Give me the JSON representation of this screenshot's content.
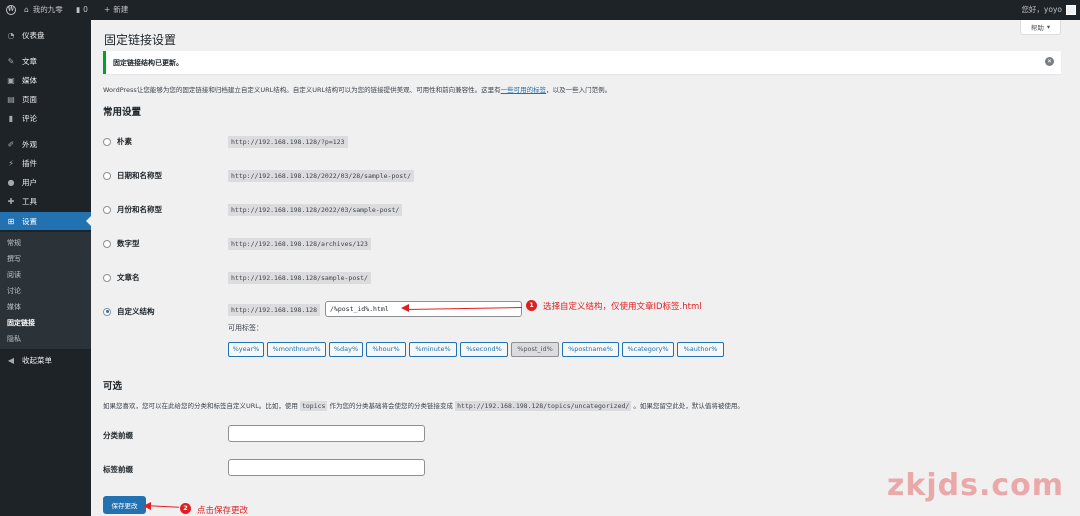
{
  "adminbar": {
    "site_name": "我的九零",
    "comments_count": "0",
    "new_label": "新建",
    "howdy": "您好，yoyo"
  },
  "sidebar": {
    "items": [
      {
        "label": "仪表盘",
        "icon": "dashboard-icon"
      },
      {
        "label": "文章",
        "icon": "pin-icon"
      },
      {
        "label": "媒体",
        "icon": "media-icon"
      },
      {
        "label": "页面",
        "icon": "page-icon"
      },
      {
        "label": "评论",
        "icon": "comment-icon"
      },
      {
        "label": "外观",
        "icon": "brush-icon"
      },
      {
        "label": "插件",
        "icon": "plugin-icon"
      },
      {
        "label": "用户",
        "icon": "user-icon"
      },
      {
        "label": "工具",
        "icon": "wrench-icon"
      },
      {
        "label": "设置",
        "icon": "settings-icon",
        "active": true
      }
    ],
    "submenu": [
      "常规",
      "撰写",
      "阅读",
      "讨论",
      "媒体",
      "固定链接",
      "隐私"
    ],
    "current_submenu": "固定链接",
    "collapse_label": "收起菜单"
  },
  "help_label": "帮助",
  "page_title": "固定链接设置",
  "notice": "固定链接结构已更新。",
  "intro": {
    "text_before": "WordPress让您能够为您的固定链接和归档建立自定义URL结构。自定义URL结构可以为您的链接提供美观、可用性和前向兼容性。这里有",
    "link": "一些可用的标签",
    "text_after": "，以及一些入门范例。"
  },
  "common_settings": {
    "heading": "常用设置",
    "options": [
      {
        "label": "朴素",
        "example": "http://192.168.198.128/?p=123",
        "checked": false
      },
      {
        "label": "日期和名称型",
        "example": "http://192.168.198.128/2022/03/28/sample-post/",
        "checked": false
      },
      {
        "label": "月份和名称型",
        "example": "http://192.168.198.128/2022/03/sample-post/",
        "checked": false
      },
      {
        "label": "数字型",
        "example": "http://192.168.198.128/archives/123",
        "checked": false
      },
      {
        "label": "文章名",
        "example": "http://192.168.198.128/sample-post/",
        "checked": false
      },
      {
        "label": "自定义结构",
        "example": "http://192.168.198.128",
        "checked": true
      }
    ],
    "custom_structure_value": "/%post_id%.html",
    "available_tags_label": "可用标签：",
    "tags": [
      "%year%",
      "%monthnum%",
      "%day%",
      "%hour%",
      "%minute%",
      "%second%",
      "%post_id%",
      "%postname%",
      "%category%",
      "%author%"
    ],
    "pressed_tag": "%post_id%"
  },
  "optional": {
    "heading": "可选",
    "desc_before": "如果您喜欢，您可以在此给您的分类和标签自定义URL。比如，使用",
    "desc_code1": "topics",
    "desc_mid": "作为您的分类基础将会使您的分类链接变成",
    "desc_code2": "http://192.168.198.128/topics/uncategorized/",
    "desc_after": "。如果您留空此处，默认值将被使用。",
    "category_base_label": "分类前缀",
    "tag_base_label": "标签前缀",
    "category_base_value": "",
    "tag_base_value": ""
  },
  "save_button": "保存更改",
  "annotations": {
    "step1_number": "1",
    "step1_text": "选择自定义结构，仅使用文章ID标签.html",
    "step2_number": "2",
    "step2_text": "点击保存更改",
    "color": "#e02020"
  },
  "watermark": "zkjds.com",
  "colors": {
    "accent": "#2271b1",
    "sidebar_bg": "#1d2327",
    "success": "#00a32a"
  }
}
